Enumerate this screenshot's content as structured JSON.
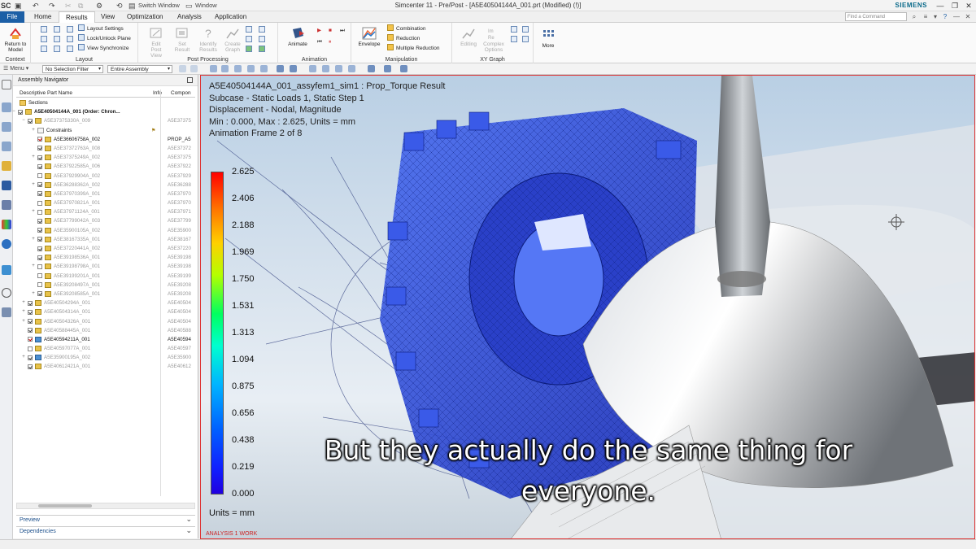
{
  "titlebar": {
    "app_badge": "SC",
    "switch_window": "Switch Window",
    "window_menu": "Window",
    "title": "Simcenter 11 - Pre/Post - [A5E40504144A_001.prt (Modified)  (!)]",
    "brand": "SIEMENS"
  },
  "tabs": [
    "File",
    "Home",
    "Results",
    "View",
    "Optimization",
    "Analysis",
    "Application"
  ],
  "active_tab": "Results",
  "command_search": {
    "placeholder": "Find a Command"
  },
  "ribbon": {
    "context": {
      "label": "Context",
      "return_to_model": "Return to Model"
    },
    "layout": {
      "label": "Layout",
      "items": [
        "Layout Settings",
        "Lock/Unlock Plane",
        "View Synchronize"
      ]
    },
    "post_processing": {
      "label": "Post Processing",
      "buttons": [
        "Edit Post View",
        "Set Result",
        "Identify Results",
        "Create Graph"
      ]
    },
    "animation": {
      "label": "Animation",
      "animate": "Animate"
    },
    "manipulation": {
      "label": "Manipulation",
      "envelope": "Envelope",
      "items": [
        "Combination",
        "Reduction",
        "Multiple Reduction"
      ]
    },
    "xy_graph": {
      "label": "XY Graph",
      "buttons": [
        "Editing",
        "Complex Options"
      ]
    },
    "more": "More"
  },
  "selection_bar": {
    "menu": "Menu",
    "filter": "No Selection Filter",
    "scope": "Entire Assembly"
  },
  "navigator": {
    "title": "Assembly Navigator",
    "columns": [
      "Descriptive Part Name",
      "Info",
      "Compon"
    ],
    "rows": [
      {
        "name": "Sections",
        "comp": ""
      },
      {
        "name": "A5E40504144A_001 (Order: Chron...",
        "comp": ""
      },
      {
        "name": "A5E37375330A_009",
        "comp": "A5E37375"
      },
      {
        "name": "Constraints",
        "comp": ""
      },
      {
        "name": "A5E36606758A_002",
        "comp": "PROP_A5"
      },
      {
        "name": "A5E37372763A_008",
        "comp": "A5E37372"
      },
      {
        "name": "A5E37375249A_002",
        "comp": "A5E37375"
      },
      {
        "name": "A5E37922585A_006",
        "comp": "A5E37922"
      },
      {
        "name": "A5E37929904A_002",
        "comp": "A5E37929"
      },
      {
        "name": "A5E36288362A_002",
        "comp": "A5E36288"
      },
      {
        "name": "A5E37970399A_001",
        "comp": "A5E37970"
      },
      {
        "name": "A5E37970821A_001",
        "comp": "A5E37970"
      },
      {
        "name": "A5E37971124A_001",
        "comp": "A5E37971"
      },
      {
        "name": "A5E37799042A_003",
        "comp": "A5E37799"
      },
      {
        "name": "A5E35900105A_002",
        "comp": "A5E35900"
      },
      {
        "name": "A5E38167335A_001",
        "comp": "A5E38167"
      },
      {
        "name": "A5E37220441A_002",
        "comp": "A5E37220"
      },
      {
        "name": "A5E39198536A_001",
        "comp": "A5E39198"
      },
      {
        "name": "A5E39198798A_001",
        "comp": "A5E39198"
      },
      {
        "name": "A5E39199201A_001",
        "comp": "A5E39199"
      },
      {
        "name": "A5E39208497A_001",
        "comp": "A5E39208"
      },
      {
        "name": "A5E39208585A_001",
        "comp": "A5E39208"
      },
      {
        "name": "A5E40504294A_001",
        "comp": "A5E40504"
      },
      {
        "name": "A5E40504314A_001",
        "comp": "A5E40504"
      },
      {
        "name": "A5E40504326A_001",
        "comp": "A5E40504"
      },
      {
        "name": "A5E40588445A_001",
        "comp": "A5E40588"
      },
      {
        "name": "A5E40594211A_001",
        "comp": "A5E40594"
      },
      {
        "name": "A5E40597077A_001",
        "comp": "A5E40597"
      },
      {
        "name": "A5E35900195A_002",
        "comp": "A5E35900"
      },
      {
        "name": "A5E40612421A_001",
        "comp": "A5E40612"
      }
    ],
    "preview": "Preview",
    "dependencies": "Dependencies"
  },
  "viewport": {
    "result_lines": [
      "A5E40504144A_001_assyfem1_sim1 : Prop_Torque Result",
      "Subcase - Static Loads 1, Static Step 1",
      "Displacement - Nodal, Magnitude",
      "Min : 0.000, Max : 2.625, Units = mm",
      "Animation Frame 2 of 8"
    ],
    "legend_values": [
      "2.625",
      "2.406",
      "2.188",
      "1.969",
      "1.750",
      "1.531",
      "1.313",
      "1.094",
      "0.875",
      "0.656",
      "0.438",
      "0.219",
      "0.000"
    ],
    "units": "Units = mm",
    "work_label": "ANALYSIS 1 WORK",
    "subtitle_line1": "But they actually do the same thing for",
    "subtitle_line2": "everyone."
  }
}
